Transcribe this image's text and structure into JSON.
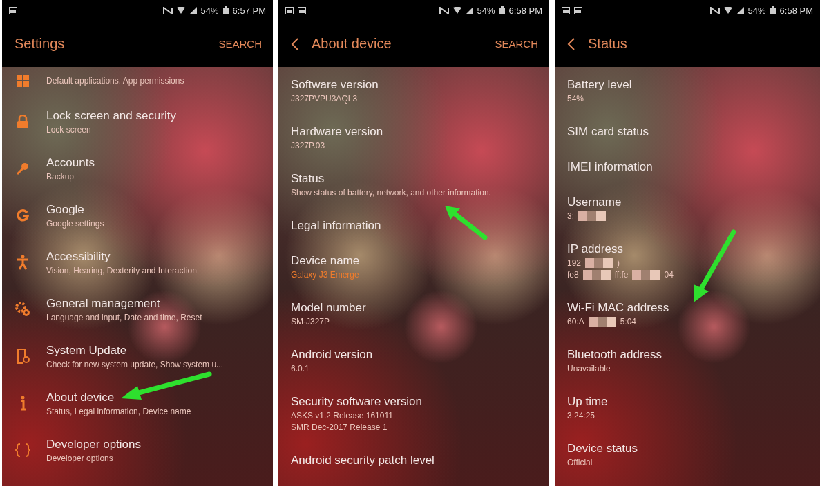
{
  "screens": [
    {
      "status_bar": {
        "battery": "54%",
        "time": "6:57 PM"
      },
      "header": {
        "back": false,
        "title": "Settings",
        "action": "SEARCH"
      },
      "items": [
        {
          "subtitle": "Default applications, App permissions",
          "accent": false
        },
        {
          "title": "Lock screen and security",
          "subtitle": "Lock screen",
          "accent": false
        },
        {
          "title": "Accounts",
          "subtitle": "Backup",
          "accent": false
        },
        {
          "title": "Google",
          "subtitle": "Google settings",
          "accent": false
        },
        {
          "title": "Accessibility",
          "subtitle": "Vision, Hearing, Dexterity and Interaction",
          "accent": false
        },
        {
          "title": "General management",
          "subtitle": "Language and input, Date and time, Reset",
          "accent": false
        },
        {
          "title": "System Update",
          "subtitle": "Check for new system update, Show system u...",
          "accent": false
        },
        {
          "title": "About device",
          "subtitle": "Status, Legal information, Device name",
          "accent": false
        },
        {
          "title": "Developer options",
          "subtitle": "Developer options",
          "accent": false
        }
      ]
    },
    {
      "status_bar": {
        "battery": "54%",
        "time": "6:58 PM"
      },
      "header": {
        "back": true,
        "title": "About device",
        "action": "SEARCH"
      },
      "items": [
        {
          "title": "Software version",
          "subtitle": "J327PVPU3AQL3",
          "accent": false
        },
        {
          "title": "Hardware version",
          "subtitle": "J327P.03",
          "accent": false
        },
        {
          "title": "Status",
          "subtitle": "Show status of battery, network, and other information.",
          "accent": false
        },
        {
          "title": "Legal information"
        },
        {
          "title": "Device name",
          "subtitle": "Galaxy J3 Emerge",
          "accent": true
        },
        {
          "title": "Model number",
          "subtitle": "SM-J327P",
          "accent": false
        },
        {
          "title": "Android version",
          "subtitle": "6.0.1",
          "accent": false
        },
        {
          "title": "Security software version",
          "subtitle": "ASKS v1.2 Release 161011",
          "subtitle_2": "SMR Dec-2017 Release 1",
          "accent": false
        },
        {
          "title": "Android security patch level"
        }
      ]
    },
    {
      "status_bar": {
        "battery": "54%",
        "time": "6:58 PM"
      },
      "header": {
        "back": true,
        "title": "Status"
      },
      "items": [
        {
          "title": "Battery level",
          "subtitle": "54%",
          "accent": false
        },
        {
          "title": "SIM card status"
        },
        {
          "title": "IMEI information"
        },
        {
          "title": "Username",
          "value_lines": [
            [
              {
                "kind": "text",
                "text": "3:"
              },
              {
                "kind": "redacted"
              }
            ]
          ]
        },
        {
          "title": "IP address",
          "value_lines": [
            [
              {
                "kind": "text",
                "text": "192"
              },
              {
                "kind": "redacted"
              },
              {
                "kind": "text",
                "text": ")"
              }
            ],
            [
              {
                "kind": "text",
                "text": "fe8"
              },
              {
                "kind": "redacted"
              },
              {
                "kind": "text",
                "text": "ff:fe"
              },
              {
                "kind": "redacted"
              },
              {
                "kind": "text",
                "text": "04"
              }
            ]
          ]
        },
        {
          "title": "Wi-Fi MAC address",
          "value_lines": [
            [
              {
                "kind": "text",
                "text": "60:A"
              },
              {
                "kind": "redacted"
              },
              {
                "kind": "text",
                "text": "5:04"
              }
            ]
          ]
        },
        {
          "title": "Bluetooth address",
          "subtitle": "Unavailable",
          "accent": false
        },
        {
          "title": "Up time",
          "subtitle": "3:24:25",
          "accent": false
        },
        {
          "title": "Device status",
          "subtitle": "Official",
          "accent": false
        }
      ]
    }
  ]
}
